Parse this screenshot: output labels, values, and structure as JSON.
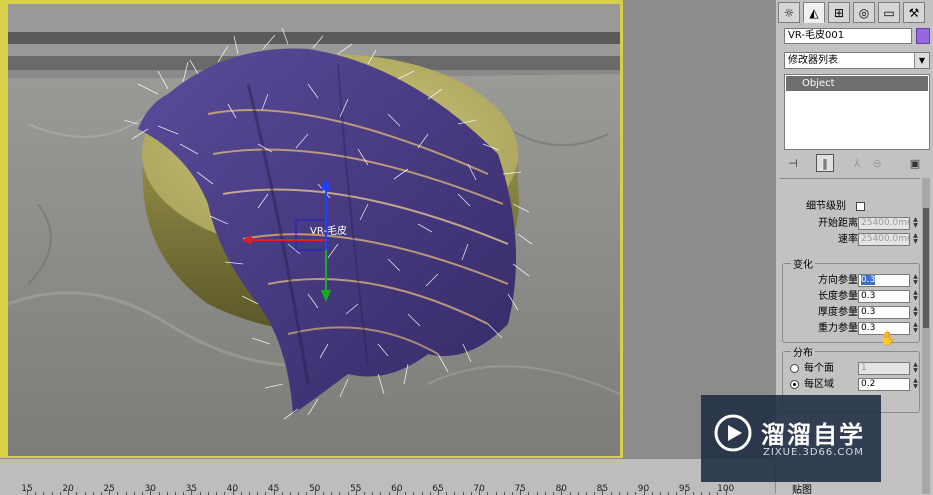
{
  "viewport": {
    "gizmo_label": "VR-毛皮"
  },
  "timeline": {
    "ticks": [
      "15",
      "20",
      "25",
      "30",
      "35",
      "40",
      "45",
      "50",
      "55",
      "60",
      "65",
      "70",
      "75",
      "80",
      "85",
      "90",
      "95",
      "100"
    ]
  },
  "command_panel": {
    "tabs": [
      {
        "name": "create",
        "icon": "☼"
      },
      {
        "name": "modify",
        "icon": "◭"
      },
      {
        "name": "hierarchy",
        "icon": "⊞"
      },
      {
        "name": "motion",
        "icon": "◎"
      },
      {
        "name": "display",
        "icon": "▭"
      },
      {
        "name": "utilities",
        "icon": "⚒"
      }
    ],
    "object_name": "VR-毛皮001",
    "object_color": "#9a66dd",
    "modifier_list_label": "修改器列表",
    "stack": {
      "items": [
        "Object"
      ]
    }
  },
  "rollout": {
    "lod_label": "细节级别",
    "start_distance_label": "开始距离",
    "start_distance_value": "25400.0mm",
    "rate_label": "速率",
    "rate_value": "25400.0mm",
    "variation": {
      "title": "变化",
      "direction_label": "方向参量",
      "direction_value": "0.3",
      "length_label": "长度参量",
      "length_value": "0.3",
      "thickness_label": "厚度参量",
      "thickness_value": "0.3",
      "gravity_label": "重力参量",
      "gravity_value": "0.3"
    },
    "distribution": {
      "title": "分布",
      "per_face_label": "每个面",
      "per_face_value": "1",
      "per_area_label": "每区域",
      "per_area_value": "0.2"
    },
    "bottom_label": "贴图"
  },
  "watermark": {
    "title": "溜溜自学",
    "url": "ZIXUE.3D66.COM"
  },
  "colors": {
    "viewport_border": "#d8cf4a",
    "cloth": "#4e3f8a",
    "cushion": "#c7c070"
  }
}
